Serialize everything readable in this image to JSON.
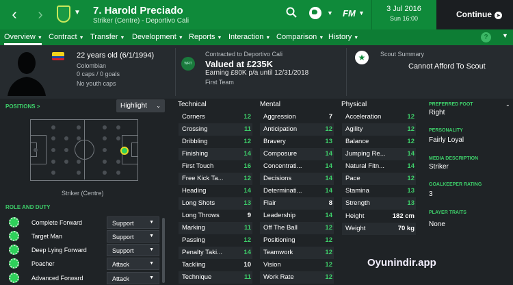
{
  "topbar": {
    "player_title": "7. Harold Preciado",
    "player_subtitle": "Striker (Centre) - Deportivo Cali",
    "fm_logo": "FM",
    "date": "3 Jul 2016",
    "time": "Sun 16:00",
    "continue_label": "Continue",
    "back_icon": "chevron-left-icon",
    "forward_icon": "chevron-right-icon",
    "search_icon": "search-icon",
    "globe_icon": "globe-icon"
  },
  "menu": [
    {
      "label": "Overview"
    },
    {
      "label": "Contract"
    },
    {
      "label": "Transfer"
    },
    {
      "label": "Development"
    },
    {
      "label": "Reports"
    },
    {
      "label": "Interaction"
    },
    {
      "label": "Comparison"
    },
    {
      "label": "History"
    }
  ],
  "header": {
    "age": "22 years old (6/1/1994)",
    "nationality": "Colombian",
    "caps": "0 caps / 0 goals",
    "youth_caps": "No youth caps",
    "contracted_to": "Contracted to Deportivo Cali",
    "value": "Valued at £235K",
    "earning": "Earning £80K p/a until 12/31/2018",
    "squad": "First Team",
    "club_badge": "WRT",
    "scout_label": "Scout Summary",
    "scout_text": "Cannot Afford To Scout"
  },
  "left": {
    "positions_label": "POSITIONS >",
    "highlight_label": "Highlight",
    "position_caption": "Striker (Centre)",
    "role_label": "ROLE AND DUTY",
    "roles": [
      {
        "name": "Complete Forward",
        "duty": "Support"
      },
      {
        "name": "Target Man",
        "duty": "Support"
      },
      {
        "name": "Deep Lying Forward",
        "duty": "Support"
      },
      {
        "name": "Poacher",
        "duty": "Attack"
      },
      {
        "name": "Advanced Forward",
        "duty": "Attack"
      }
    ]
  },
  "attributes": {
    "technical_label": "Technical",
    "mental_label": "Mental",
    "physical_label": "Physical",
    "technical": [
      {
        "name": "Corners",
        "value": "12"
      },
      {
        "name": "Crossing",
        "value": "11"
      },
      {
        "name": "Dribbling",
        "value": "12"
      },
      {
        "name": "Finishing",
        "value": "14"
      },
      {
        "name": "First Touch",
        "value": "16"
      },
      {
        "name": "Free Kick Ta...",
        "value": "12"
      },
      {
        "name": "Heading",
        "value": "14"
      },
      {
        "name": "Long Shots",
        "value": "13"
      },
      {
        "name": "Long Throws",
        "value": "9"
      },
      {
        "name": "Marking",
        "value": "11"
      },
      {
        "name": "Passing",
        "value": "12"
      },
      {
        "name": "Penalty Taki...",
        "value": "14"
      },
      {
        "name": "Tackling",
        "value": "10"
      },
      {
        "name": "Technique",
        "value": "11"
      }
    ],
    "mental": [
      {
        "name": "Aggression",
        "value": "7"
      },
      {
        "name": "Anticipation",
        "value": "12"
      },
      {
        "name": "Bravery",
        "value": "13"
      },
      {
        "name": "Composure",
        "value": "14"
      },
      {
        "name": "Concentrati...",
        "value": "14"
      },
      {
        "name": "Decisions",
        "value": "14"
      },
      {
        "name": "Determinati...",
        "value": "14"
      },
      {
        "name": "Flair",
        "value": "8"
      },
      {
        "name": "Leadership",
        "value": "14"
      },
      {
        "name": "Off The Ball",
        "value": "12"
      },
      {
        "name": "Positioning",
        "value": "12"
      },
      {
        "name": "Teamwork",
        "value": "12"
      },
      {
        "name": "Vision",
        "value": "12"
      },
      {
        "name": "Work Rate",
        "value": "12"
      }
    ],
    "physical": [
      {
        "name": "Acceleration",
        "value": "12"
      },
      {
        "name": "Agility",
        "value": "12"
      },
      {
        "name": "Balance",
        "value": "12"
      },
      {
        "name": "Jumping Re...",
        "value": "14"
      },
      {
        "name": "Natural Fitn...",
        "value": "14"
      },
      {
        "name": "Pace",
        "value": "12"
      },
      {
        "name": "Stamina",
        "value": "13"
      },
      {
        "name": "Strength",
        "value": "13"
      }
    ],
    "height_label": "Height",
    "height_value": "182 cm",
    "weight_label": "Weight",
    "weight_value": "70 kg"
  },
  "sidebar": {
    "preferred_foot_label": "PREFERRED FOOT",
    "preferred_foot": "Right",
    "personality_label": "PERSONALITY",
    "personality": "Fairly Loyal",
    "media_label": "MEDIA DESCRIPTION",
    "media": "Striker",
    "gk_label": "GOALKEEPER RATING",
    "gk_value": "3",
    "traits_label": "PLAYER TRAITS",
    "traits": "None"
  },
  "watermark": "Oyunindir.app",
  "colors": {
    "brand_green": "#0f8a3a",
    "accent_green": "#3ecf6a",
    "panel_dark": "#1f2326"
  }
}
